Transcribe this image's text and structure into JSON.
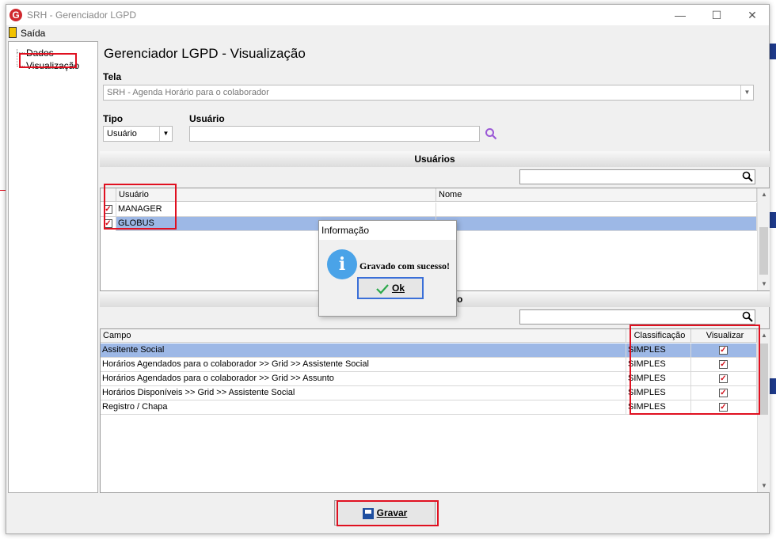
{
  "window": {
    "title": "SRH - Gerenciador LGPD",
    "minimize": "—",
    "maximize": "☐",
    "close": "✕"
  },
  "menu": {
    "exit_label": "Saída"
  },
  "tree": {
    "items": [
      {
        "label": "Dados"
      },
      {
        "label": "Visualização"
      }
    ]
  },
  "page_title": "Gerenciador LGPD - Visualização",
  "tela": {
    "label": "Tela",
    "value": "SRH - Agenda Horário para o colaborador"
  },
  "tipo": {
    "label": "Tipo",
    "value": "Usuário"
  },
  "usuario": {
    "label": "Usuário",
    "value": ""
  },
  "users_section": {
    "title": "Usuários",
    "search_value": "",
    "columns": [
      "Usuário",
      "Nome"
    ],
    "rows": [
      {
        "checked": true,
        "usuario": "MANAGER",
        "nome": ""
      },
      {
        "checked": true,
        "usuario": "GLOBUS",
        "nome": ""
      }
    ]
  },
  "fields_section": {
    "title_visible": "o",
    "search_value": "",
    "columns": [
      "Campo",
      "Classificação",
      "Visualizar"
    ],
    "rows": [
      {
        "campo": "Assitente Social",
        "classificacao": "SIMPLES",
        "visualizar": true
      },
      {
        "campo": "Horários Agendados para o colaborador >> Grid >> Assistente Social",
        "classificacao": "SIMPLES",
        "visualizar": true
      },
      {
        "campo": "Horários Agendados para o colaborador >> Grid >> Assunto",
        "classificacao": "SIMPLES",
        "visualizar": true
      },
      {
        "campo": "Horários Disponíveis >> Grid >> Assistente Social",
        "classificacao": "SIMPLES",
        "visualizar": true
      },
      {
        "campo": "Registro / Chapa",
        "classificacao": "SIMPLES",
        "visualizar": true
      }
    ]
  },
  "dialog": {
    "title": "Informação",
    "message": "Gravado com sucesso!",
    "ok_label": "Ok",
    "info_glyph": "i"
  },
  "buttons": {
    "gravar_label": "Gravar"
  },
  "colors": {
    "accent_red": "#e01020",
    "selection": "#9db8e6",
    "info_blue": "#4aa3e8"
  }
}
